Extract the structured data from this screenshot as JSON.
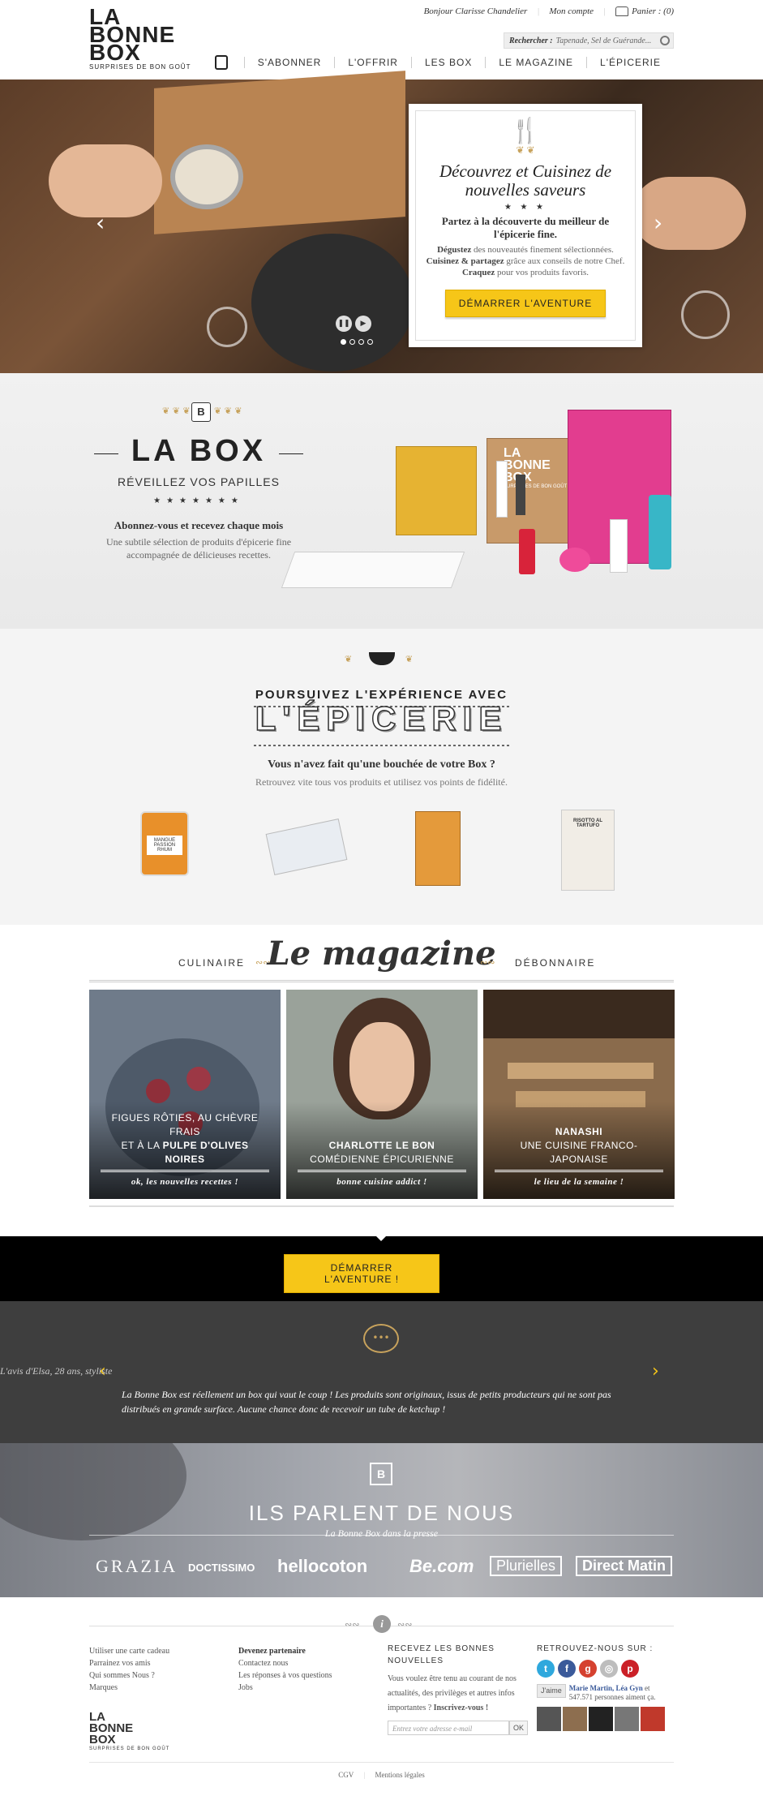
{
  "header": {
    "logo_line1": "LA",
    "logo_line2": "BONNE",
    "logo_line3": "BOX",
    "logo_tagline": "SURPRISES DE BON GOÛT",
    "greeting": "Bonjour Clarisse Chandelier",
    "account": "Mon compte",
    "cart": "Panier : (0)",
    "search_label": "Rechercher :",
    "search_placeholder": "Tapenade, Sel de Guérande...",
    "nav": [
      "S'ABONNER",
      "L'OFFRIR",
      "LES BOX",
      "LE MAGAZINE",
      "L'ÉPICERIE"
    ]
  },
  "hero": {
    "title": "Découvrez et Cuisinez de nouvelles saveurs",
    "stars": "★ ★ ★",
    "lead": "Partez à la découverte du meilleur de l'épicerie fine.",
    "body_b1": "Dégustez",
    "body_t1": " des nouveautés finement sélectionnées. ",
    "body_b2": "Cuisinez & partagez",
    "body_t2": " grâce aux conseils de notre Chef. ",
    "body_b3": "Craquez",
    "body_t3": " pour vos produits favoris.",
    "cta": "DÉMARRER L'AVENTURE",
    "slide_count": 4,
    "active_slide": 1
  },
  "box": {
    "badge": "B",
    "title": "LA BOX",
    "subtitle": "RÉVEILLEZ VOS PAPILLES",
    "stars": "★★★★★★★",
    "lead": "Abonnez-vous et recevez chaque mois",
    "body": "Une subtile sélection de produits d'épicerie fine accompagnée de délicieuses recettes.",
    "box_logo_1": "LA",
    "box_logo_2": "BONNE",
    "box_logo_3": "BOX",
    "box_tagline": "SURPRISES DE BON GOÛT"
  },
  "epicerie": {
    "heading": "POURSUIVEZ L'EXPÉRIENCE AVEC",
    "big": "L'ÉPICERIE",
    "lead": "Vous n'avez fait qu'une bouchée de votre Box ?",
    "body": "Retrouvez vite tous vos produits et utilisez vos points de fidélité.",
    "jar_label": "MANGUE PASSION RHUM",
    "bag_label": "RISOTTO AL TARTUFO"
  },
  "magazine": {
    "left": "CULINAIRE",
    "title": "Le magazine",
    "right": "DÉBONNAIRE",
    "cards": [
      {
        "line1": "FIGUES RÔTIES, AU CHÈVRE FRAIS",
        "line2_pre": "ET À LA ",
        "line2_bold": "PULPE D'OLIVES NOIRES",
        "tag": "ok, les nouvelles recettes !"
      },
      {
        "line1": "CHARLOTTE LE BON",
        "line2_pre": "COMÉDIENNE ÉPICURIENNE",
        "line2_bold": "",
        "tag": "bonne cuisine addict !"
      },
      {
        "line1": "NANASHI",
        "line2_pre": "UNE CUISINE FRANCO-JAPONAISE",
        "line2_bold": "",
        "tag": "le lieu de la semaine !"
      }
    ]
  },
  "cta_band": {
    "label": "DÉMARRER L'AVENTURE !"
  },
  "testimonial": {
    "author": "L'avis d'Elsa, 28 ans, styliste",
    "quote": "La Bonne Box est réellement un box qui vaut le coup !  Les produits sont originaux, issus de petits producteurs qui ne sont pas distribués en grande surface.  Aucune chance donc de recevoir un tube de ketchup !"
  },
  "press": {
    "title": "ILS PARLENT DE NOUS",
    "subtitle": "La Bonne Box dans la presse",
    "logos": [
      "GRAZIA",
      "DOCTISSIMO",
      "hellocoton",
      "Be.com",
      "Plurielles",
      "Direct Matin"
    ]
  },
  "footer": {
    "col1": [
      "Utiliser une carte cadeau",
      "Parrainez vos amis",
      "Qui sommes Nous ?",
      "Marques"
    ],
    "col2_head": "Devenez partenaire",
    "col2": [
      "Contactez nous",
      "Les réponses à vos questions",
      "Jobs"
    ],
    "newsletter_head": "RECEVEZ LES BONNES NOUVELLES",
    "newsletter_body": "Vous voulez être tenu au courant de nos actualités, des privilèges et autres infos importantes ?",
    "newsletter_bold": "Inscrivez-vous !",
    "newsletter_placeholder": "Entrez votre adresse e-mail",
    "ok": "OK",
    "social_head": "RETROUVEZ-NOUS SUR :",
    "like": "J'aime",
    "like_people": "Marie Martin, Léa Gyn",
    "like_count": "et 547.571 personnes aiment ça.",
    "legal": [
      "CGV",
      "Mentions légales"
    ],
    "logo_1": "LA",
    "logo_2": "BONNE",
    "logo_3": "BOX",
    "logo_tag": "SURPRISES DE BON GOÛT"
  },
  "colors": {
    "accent": "#f6c618",
    "gold": "#c7a25c",
    "dark": "#3e3e3e"
  }
}
